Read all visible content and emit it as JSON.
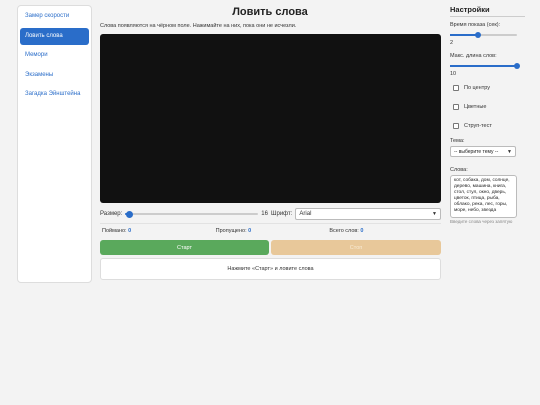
{
  "sidebar": {
    "items": [
      {
        "label": "Замер скорости",
        "active": false
      },
      {
        "label": "Ловить слова",
        "active": true
      },
      {
        "label": "Мемори",
        "active": false
      },
      {
        "label": "Экзамены",
        "active": false
      },
      {
        "label": "Загадка Эйнштейна",
        "active": false
      }
    ]
  },
  "main": {
    "title": "Ловить слова",
    "instruction": "Слова появляются на чёрном поле. Нажимайте на них, пока они не исчезли.",
    "controls": {
      "size_label": "Размер:",
      "size_value": "16",
      "size_fraction": 0.03,
      "font_label": "Шрифт:",
      "font_value": "Arial"
    },
    "stats": {
      "caught_label": "Поймано:",
      "caught": "0",
      "missed_label": "Пропущено:",
      "missed": "0",
      "total_label": "Всего слов:",
      "total": "0"
    },
    "start_label": "Старт",
    "stop_label": "Стоп",
    "status": "Нажмите «Старт» и ловите слова"
  },
  "settings": {
    "title": "Настройки",
    "show_time_label": "Время показа (сек):",
    "show_time_value": "2",
    "show_time_fraction": 0.42,
    "max_len_label": "Макс. длина слов:",
    "max_len_value": "10",
    "max_len_fraction": 1.0,
    "center_label": "По центру",
    "colored_label": "Цветные",
    "stroop_label": "Струп-тест",
    "theme_label": "Тема:",
    "theme_value": "-- выберите тему --",
    "words_label": "Слова:",
    "words_text": "кот, собака, дом, солнце, дерево, машина, книга, стол, стул, окно, дверь, цветок, птица, рыба, облако, река, лес, горы, море, небо, звезда",
    "words_hint": "Введите слова через запятую"
  },
  "colors": {
    "accent": "#2a6dc9",
    "start": "#5aa95c",
    "stop": "#e8c89a",
    "field": "#111111"
  }
}
